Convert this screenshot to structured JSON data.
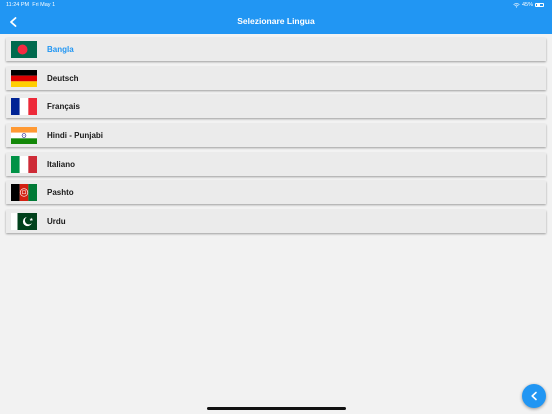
{
  "status_bar": {
    "time": "11:24 PM",
    "date": "Fri May 1",
    "battery": "45%"
  },
  "header": {
    "title": "Selezionare Lingua",
    "back_icon": "chevron-left-icon"
  },
  "languages": [
    {
      "label": "Bangla",
      "flag": "bangladesh",
      "selected": true
    },
    {
      "label": "Deutsch",
      "flag": "germany",
      "selected": false
    },
    {
      "label": "Français",
      "flag": "france",
      "selected": false
    },
    {
      "label": "Hindi - Punjabi",
      "flag": "india",
      "selected": false
    },
    {
      "label": "Italiano",
      "flag": "italy",
      "selected": false
    },
    {
      "label": "Pashto",
      "flag": "afghanistan",
      "selected": false
    },
    {
      "label": "Urdu",
      "flag": "pakistan",
      "selected": false
    }
  ],
  "colors": {
    "accent": "#2196f3",
    "row_bg": "#ebebeb",
    "page_bg": "#f2f2f2",
    "selected_text": "#2196f3"
  },
  "fab": {
    "icon": "chevron-left-icon"
  }
}
